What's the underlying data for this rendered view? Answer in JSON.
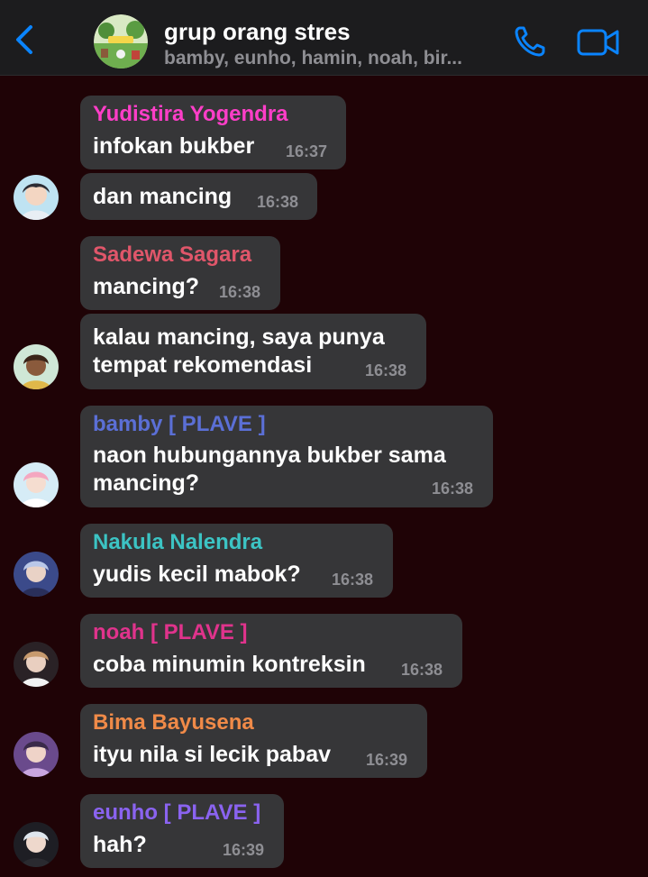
{
  "header": {
    "title": "grup orang stres",
    "members": "bamby, eunho, hamin, noah, bir...",
    "colors": {
      "accent": "#0a84ff",
      "background": "#1c1c1e"
    },
    "icons": {
      "back": "chevron-left-icon",
      "call": "phone-icon",
      "video": "video-camera-icon"
    }
  },
  "chat": {
    "background": "#1f0306",
    "bubble_color": "#363638",
    "messages": [
      {
        "sender": "Yudistira Yogendra",
        "sender_color": "#ff3ec8",
        "lines": [
          "infokan bukber"
        ],
        "time": "16:37"
      },
      {
        "sender": "",
        "lines": [
          "dan mancing"
        ],
        "time": "16:38"
      },
      {
        "sender": "Sadewa Sagara",
        "sender_color": "#e0566a",
        "lines": [
          "mancing?"
        ],
        "time": "16:38"
      },
      {
        "sender": "",
        "lines": [
          "kalau mancing, saya punya",
          "tempat rekomendasi"
        ],
        "time": "16:38"
      },
      {
        "sender": "bamby [ PLAVE ]",
        "sender_color": "#5b6fd6",
        "lines": [
          "naon hubungannya bukber sama",
          "mancing?"
        ],
        "time": "16:38"
      },
      {
        "sender": "Nakula Nalendra",
        "sender_color": "#3cc4c4",
        "lines": [
          "yudis kecil mabok?"
        ],
        "time": "16:38"
      },
      {
        "sender": "noah [ PLAVE ]",
        "sender_color": "#e0338c",
        "lines": [
          "coba minumin kontreksin"
        ],
        "time": "16:38"
      },
      {
        "sender": "Bima Bayusena",
        "sender_color": "#f08a48",
        "lines": [
          "ityu nila si lecik pabav"
        ],
        "time": "16:39"
      },
      {
        "sender": "eunho [ PLAVE ]",
        "sender_color": "#8a63f0",
        "lines": [
          "hah?"
        ],
        "time": "16:39"
      }
    ]
  }
}
